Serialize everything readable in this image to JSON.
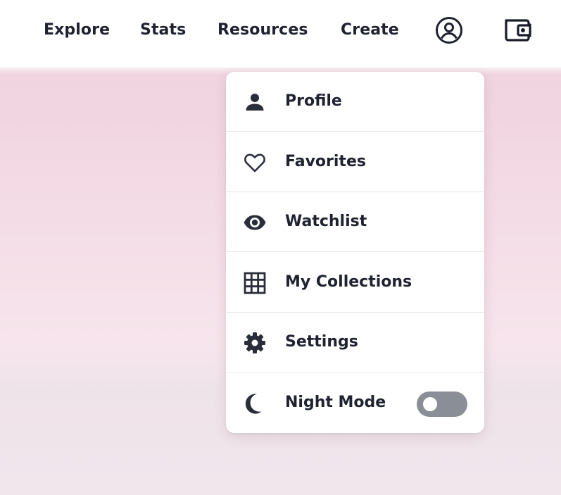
{
  "nav": {
    "links": [
      "Explore",
      "Stats",
      "Resources",
      "Create"
    ],
    "account_icon": "account-circle-icon",
    "wallet_icon": "wallet-icon"
  },
  "dropdown": {
    "items": [
      {
        "label": "Profile",
        "icon": "person-icon"
      },
      {
        "label": "Favorites",
        "icon": "heart-outline-icon"
      },
      {
        "label": "Watchlist",
        "icon": "eye-icon"
      },
      {
        "label": "My Collections",
        "icon": "grid-icon"
      },
      {
        "label": "Settings",
        "icon": "gear-icon"
      },
      {
        "label": "Night Mode",
        "icon": "moon-icon"
      }
    ],
    "night_mode_enabled": false
  },
  "colors": {
    "text": "#1f2230",
    "toggle_off": "#8a8e96",
    "hero_pink": "#f2d8e3"
  }
}
